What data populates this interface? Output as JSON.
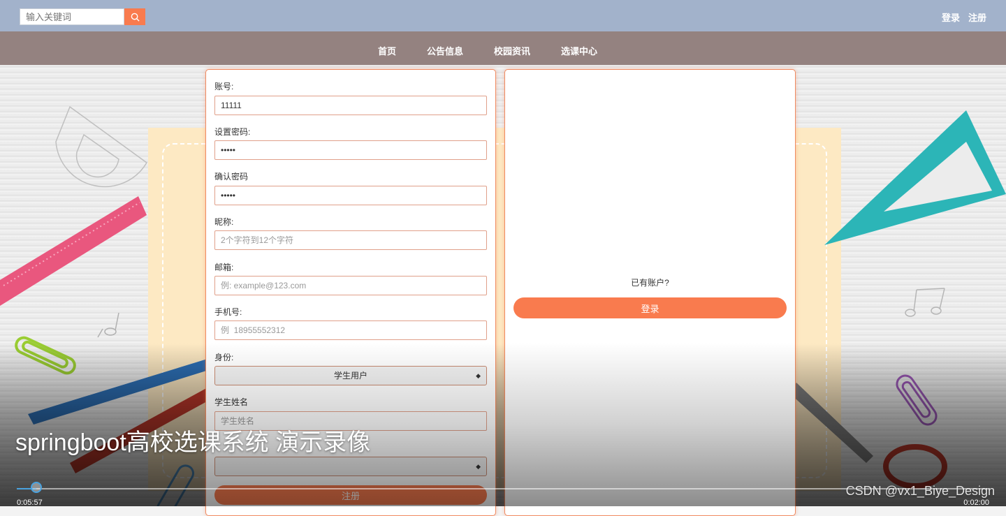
{
  "header": {
    "search": {
      "placeholder": "输入关键词",
      "value": ""
    },
    "login_link": "登录",
    "register_link": "注册"
  },
  "nav": {
    "items": [
      {
        "label": "首页"
      },
      {
        "label": "公告信息"
      },
      {
        "label": "校园资讯"
      },
      {
        "label": "选课中心"
      }
    ]
  },
  "register_form": {
    "account": {
      "label": "账号:",
      "value": "11111"
    },
    "password": {
      "label": "设置密码:",
      "value": "•••••"
    },
    "confirm_password": {
      "label": "确认密码",
      "value": "•••••"
    },
    "nickname": {
      "label": "昵称:",
      "placeholder": "2个字符到12个字符"
    },
    "email": {
      "label": "邮箱:",
      "placeholder": "例: example@123.com"
    },
    "phone": {
      "label": "手机号:",
      "placeholder": "例  18955552312"
    },
    "identity": {
      "label": "身份:",
      "selected": "学生用户"
    },
    "student_name": {
      "label": "学生姓名",
      "placeholder": "学生姓名"
    },
    "submit_label": "注册"
  },
  "login_panel": {
    "prompt": "已有账户?",
    "login_button": "登录"
  },
  "video": {
    "title": "springboot高校选课系统 演示录像",
    "current_time": "0:05:57",
    "total_time": "0:02:00",
    "progress": 0.02,
    "watermark": "CSDN @vx1_Biye_Design"
  },
  "colors": {
    "accent": "#f97b4e",
    "topbar": "#a2b2cb",
    "navbar": "#948280",
    "progress": "#4aa3e0"
  }
}
